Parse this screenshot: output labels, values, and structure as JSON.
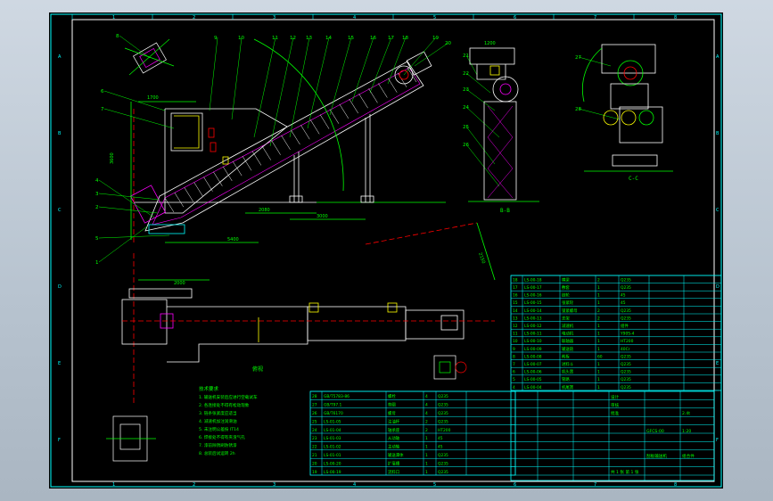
{
  "viewport": {
    "label": "CAD model space"
  },
  "sheet": {
    "border_letters_left": [
      "A",
      "B",
      "C",
      "D",
      "E",
      "F"
    ],
    "border_numbers_top": [
      "1",
      "2",
      "3",
      "4",
      "5",
      "6",
      "7",
      "8"
    ],
    "section_label_bottom": "B-B",
    "section_label_right": "C-C",
    "plan_label": "俯视"
  },
  "dimensions": {
    "d1": "1700",
    "d2": "2000",
    "d3": "3600",
    "d4": "2080",
    "d5": "5400",
    "d6": "2150",
    "d7": "1200",
    "d8": "3000"
  },
  "part_numbers": [
    "1",
    "2",
    "3",
    "4",
    "5",
    "6",
    "7",
    "8",
    "9",
    "10",
    "11",
    "12",
    "13",
    "14",
    "15",
    "16",
    "17",
    "18",
    "19",
    "20",
    "21",
    "22",
    "23",
    "24",
    "25",
    "26",
    "27",
    "28"
  ],
  "notes": {
    "title": "技术要求",
    "lines": [
      "1. 输送机安装后应进行空载试车",
      "2. 各连接处不得有松动现象",
      "3. 链条张紧度应适当",
      "4. 减速机加注润滑油",
      "5. 未注明公差按 IT14",
      "6. 焊接处不得有夹渣气孔",
      "7. 漆前除锈刷防锈漆",
      "8. 总装后试运转 2h"
    ]
  },
  "parts_table_main": {
    "rows": [
      [
        "28",
        "GB/T5783-86",
        "螺栓",
        "4",
        "Q235"
      ],
      [
        "27",
        "GB/T97.1",
        "垫圈",
        "4",
        "Q235"
      ],
      [
        "26",
        "GB/T6170",
        "螺母",
        "4",
        "Q235"
      ],
      [
        "25",
        "LS-01-05",
        "注油杯",
        "2",
        "Q235"
      ],
      [
        "24",
        "LS-01-04",
        "轴承座",
        "2",
        "HT200"
      ],
      [
        "23",
        "LS-01-03",
        "从动轴",
        "1",
        "45"
      ],
      [
        "22",
        "LS-01-02",
        "主动轴",
        "1",
        "45"
      ],
      [
        "21",
        "LS-01-01",
        "输送潭体",
        "1",
        "Q235"
      ],
      [
        "20",
        "LS-00-20",
        "扩毫槽",
        "1",
        "Q235"
      ],
      [
        "19",
        "LS-00-19",
        "流料口",
        "1",
        "Q235"
      ]
    ]
  },
  "parts_table_right": {
    "rows": [
      [
        "18",
        "LS-00-18",
        "横梁",
        "2",
        "Q235"
      ],
      [
        "17",
        "LS-00-17",
        "敷套",
        "1",
        "Q235"
      ],
      [
        "16",
        "LS-00-16",
        "链轮",
        "1",
        "45"
      ],
      [
        "15",
        "LS-00-15",
        "张紧轮",
        "1",
        "45"
      ],
      [
        "14",
        "LS-00-14",
        "锁紧螺母",
        "2",
        "Q235"
      ],
      [
        "13",
        "LS-00-13",
        "支架",
        "2",
        "Q235"
      ],
      [
        "12",
        "LS-00-12",
        "减速机",
        "1",
        "组件"
      ],
      [
        "11",
        "LS-00-11",
        "电动机",
        "1",
        "Y90S-4"
      ],
      [
        "10",
        "LS-00-10",
        "联轴器",
        "1",
        "HT200"
      ],
      [
        "9",
        "LS-00-09",
        "输送链",
        "1",
        "40Cr"
      ],
      [
        "8",
        "LS-00-08",
        "削板",
        "60",
        "Q235"
      ],
      [
        "7",
        "LS-00-07",
        "进料斗",
        "1",
        "Q235"
      ],
      [
        "6",
        "LS-00-06",
        "机头寶",
        "1",
        "Q235"
      ],
      [
        "5",
        "LS-00-05",
        "管路",
        "1",
        "Q235"
      ],
      [
        "4",
        "LS-00-04",
        "机尾寶",
        "1",
        "Q235"
      ]
    ]
  },
  "title_block": {
    "title": "刮板输送机",
    "drawing_no": "GFCS-00",
    "scale": "1:20",
    "sheet": "共 1 张 第 1 张",
    "designer": "设计",
    "checker": "审核",
    "approver": "批准",
    "material": "组合件",
    "weight": "2.4t"
  },
  "colors": {
    "background": "#000000",
    "frame": "#00ffff",
    "geometry": "#ffffff",
    "dimension": "#00ff00",
    "hidden": "#ff0000",
    "accent": "#ff00ff",
    "yellow": "#ffff00"
  }
}
